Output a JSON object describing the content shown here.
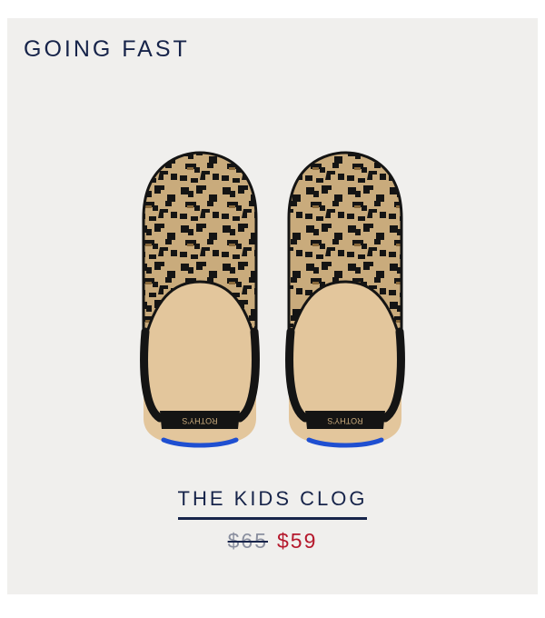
{
  "badge": "GOING FAST",
  "product": {
    "name": "THE KIDS CLOG",
    "old_price": "$65",
    "sale_price": "$59",
    "brand_mark": "ROTHY'S"
  },
  "colors": {
    "navy": "#17244a",
    "sale_red": "#b5182c",
    "background": "#f0efed"
  }
}
